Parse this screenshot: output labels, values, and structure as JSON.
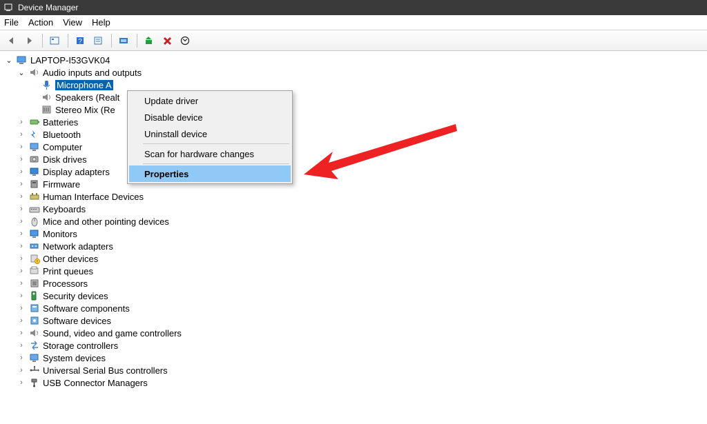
{
  "window": {
    "title": "Device Manager"
  },
  "menubar": {
    "file": "File",
    "action": "Action",
    "view": "View",
    "help": "Help"
  },
  "tree": {
    "root": "LAPTOP-I53GVK04",
    "audio": {
      "label": "Audio inputs and outputs",
      "mic": "Microphone A",
      "speakers": "Speakers (Realt",
      "stereomix": "Stereo Mix (Re"
    },
    "categories": [
      "Batteries",
      "Bluetooth",
      "Computer",
      "Disk drives",
      "Display adapters",
      "Firmware",
      "Human Interface Devices",
      "Keyboards",
      "Mice and other pointing devices",
      "Monitors",
      "Network adapters",
      "Other devices",
      "Print queues",
      "Processors",
      "Security devices",
      "Software components",
      "Software devices",
      "Sound, video and game controllers",
      "Storage controllers",
      "System devices",
      "Universal Serial Bus controllers",
      "USB Connector Managers"
    ]
  },
  "context_menu": {
    "update": "Update driver",
    "disable": "Disable device",
    "uninstall": "Uninstall device",
    "scan": "Scan for hardware changes",
    "properties": "Properties"
  },
  "icons": {
    "computer": "🖥",
    "speaker": "🔊",
    "battery": "🔋",
    "bluetooth": "ᚼ",
    "monitor": "🖵",
    "disk": "💽",
    "display": "🖥",
    "firmware": "⚙",
    "hid": "⌨",
    "keyboard": "⌨",
    "mouse": "🖱",
    "net": "🖧",
    "warn": "⚠",
    "print": "🖨",
    "cpu": "▣",
    "security": "🔒",
    "soft": "◧",
    "sound": "🎵",
    "storage": "⇆",
    "system": "🖳",
    "usb": "⏚"
  }
}
